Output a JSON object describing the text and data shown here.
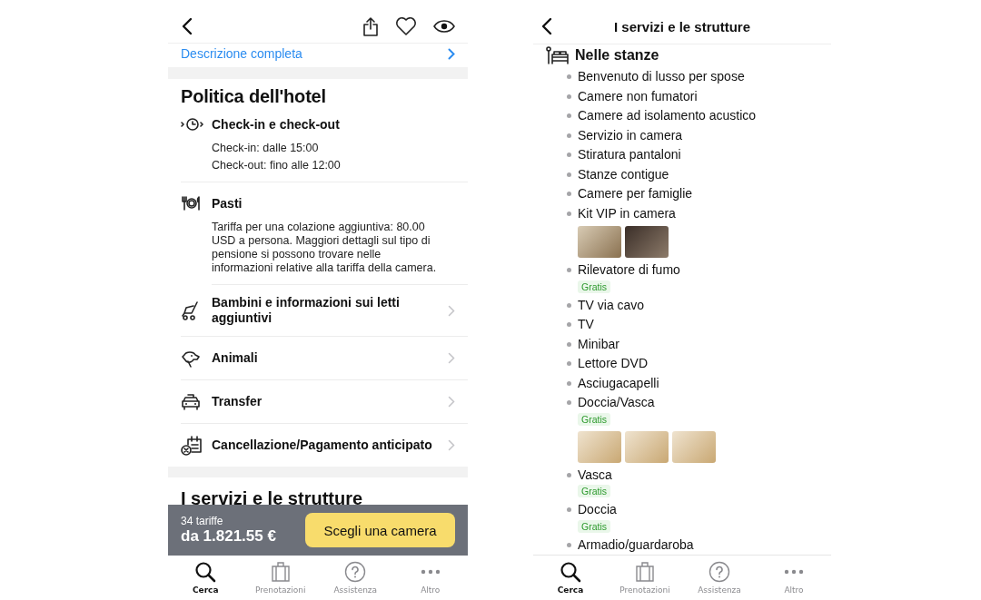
{
  "left_screen": {
    "description_link": "Descrizione completa",
    "policy": {
      "title": "Politica dell'hotel",
      "sections": [
        {
          "kind": "detail",
          "title": "Check-in e check-out",
          "lines": [
            "Check-in: dalle 15:00",
            "Check-out: fino alle 12:00"
          ]
        },
        {
          "kind": "detail",
          "title": "Pasti",
          "lines": [
            "Tariffa per una colazione aggiuntiva: 80.00 USD a persona. Maggiori dettagli sul tipo di pensione si possono trovare nelle informazioni relative alla tariffa della camera."
          ]
        },
        {
          "kind": "link",
          "title": "Bambini e informazioni sui letti aggiuntivi"
        },
        {
          "kind": "link",
          "title": "Animali"
        },
        {
          "kind": "link",
          "title": "Transfer"
        },
        {
          "kind": "link",
          "title": "Cancellazione/Pagamento anticipato"
        }
      ]
    },
    "amenities_title": "I servizi e le strutture",
    "booking_bar": {
      "rates": "34 tariffe",
      "price": "da 1.821.55 €",
      "button": "Scegli una camera"
    },
    "tabs": [
      {
        "label": "Cerca",
        "selected": true
      },
      {
        "label": "Prenotazioni",
        "selected": false
      },
      {
        "label": "Assistenza",
        "selected": false
      },
      {
        "label": "Altro",
        "selected": false
      }
    ]
  },
  "right_screen": {
    "title": "I servizi e le strutture",
    "category": "Nelle stanze",
    "items": [
      {
        "label": "Benvenuto di lusso per spose"
      },
      {
        "label": "Camere non fumatori"
      },
      {
        "label": "Camere ad isolamento acustico"
      },
      {
        "label": "Servizio in camera"
      },
      {
        "label": "Stiratura pantaloni"
      },
      {
        "label": "Stanze contigue"
      },
      {
        "label": "Camere per famiglie"
      },
      {
        "label": "Kit VIP in camera",
        "photos": [
          {
            "kind": "room"
          },
          {
            "kind": "dark-room"
          }
        ]
      },
      {
        "label": "Rilevatore di fumo",
        "badge": "Gratis"
      },
      {
        "label": "TV via cavo"
      },
      {
        "label": "TV"
      },
      {
        "label": "Minibar"
      },
      {
        "label": "Lettore DVD"
      },
      {
        "label": "Asciugacapelli"
      },
      {
        "label": "Doccia/Vasca",
        "badge": "Gratis",
        "photos": [
          {
            "kind": "bathroom"
          },
          {
            "kind": "bathroom"
          },
          {
            "kind": "bathroom"
          }
        ]
      },
      {
        "label": "Vasca",
        "badge": "Gratis"
      },
      {
        "label": "Doccia",
        "badge": "Gratis"
      },
      {
        "label": "Armadio/guardaroba"
      }
    ],
    "tabs": [
      {
        "label": "Cerca",
        "selected": true
      },
      {
        "label": "Prenotazioni",
        "selected": false
      },
      {
        "label": "Assistenza",
        "selected": false
      },
      {
        "label": "Altro",
        "selected": false
      }
    ]
  }
}
